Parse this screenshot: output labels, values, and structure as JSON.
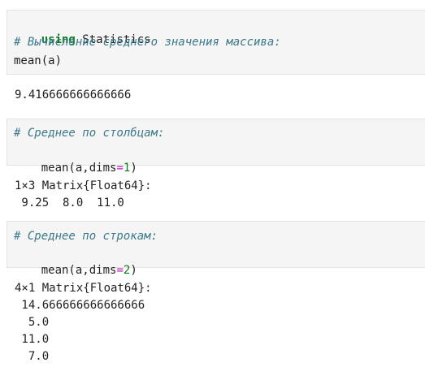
{
  "cells": [
    {
      "input": {
        "line1_keyword": "using",
        "line1_rest": " Statistics",
        "line2_comment": "# Вычисление среднего значения массива:",
        "line3": "mean(a)"
      },
      "output": [
        "9.416666666666666"
      ]
    },
    {
      "input": {
        "line1_comment": "# Среднее по столбцам:",
        "line2_prefix": "mean(a,dims",
        "line2_op": "=",
        "line2_num": "1",
        "line2_suffix": ")"
      },
      "output": [
        "1×3 Matrix{Float64}:",
        " 9.25  8.0  11.0"
      ]
    },
    {
      "input": {
        "line1_comment": "# Среднее по строкам:",
        "line2_prefix": "mean(a,dims",
        "line2_op": "=",
        "line2_num": "2",
        "line2_suffix": ")"
      },
      "output": [
        "4×1 Matrix{Float64}:",
        " 14.666666666666666",
        "  5.0",
        " 11.0",
        "  7.0"
      ]
    }
  ]
}
